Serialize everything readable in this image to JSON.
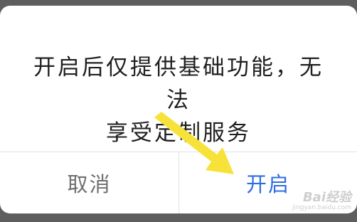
{
  "dialog": {
    "message_line1": "开启后仅提供基础功能，无法",
    "message_line2": "享受定制服务",
    "cancel_label": "取消",
    "open_label": "开启"
  },
  "watermark": {
    "main": "Bai经验",
    "sub": "jingyan.baidu.com"
  },
  "colors": {
    "overlay": "#5e5e5e",
    "dialog_bg": "#ffffff",
    "cancel_text": "#6f6f6f",
    "open_text": "#2f6de0",
    "annotation_arrow": "#f7e23a"
  },
  "icons": {
    "annotation_arrow": "arrow-pointing-down-right"
  }
}
